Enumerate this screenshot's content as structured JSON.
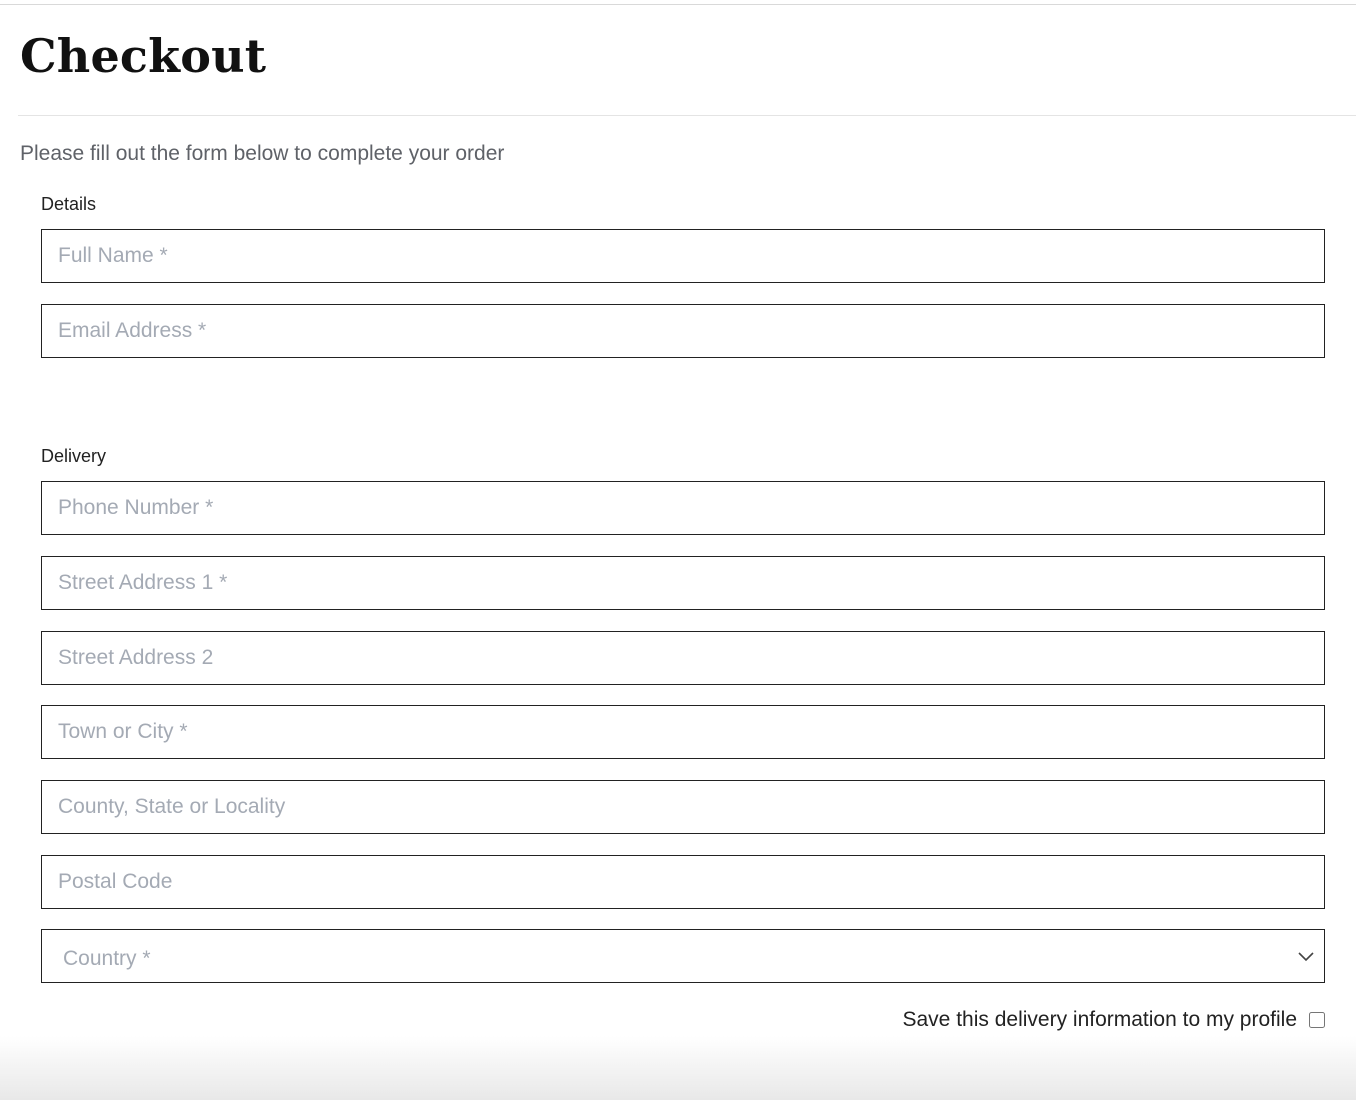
{
  "page": {
    "title": "Checkout",
    "intro": "Please fill out the form below to complete your order"
  },
  "details": {
    "label": "Details",
    "full_name_placeholder": "Full Name *",
    "email_placeholder": "Email Address *"
  },
  "delivery": {
    "label": "Delivery",
    "phone_placeholder": "Phone Number *",
    "street1_placeholder": "Street Address 1 *",
    "street2_placeholder": "Street Address 2",
    "town_placeholder": "Town or City *",
    "county_placeholder": "County, State or Locality",
    "postcode_placeholder": "Postal Code",
    "country_selected": "Country *",
    "save_label": "Save this delivery information to my profile",
    "save_checked": false
  },
  "icons": {
    "country_dropdown": "chevron-down-icon"
  },
  "colors": {
    "placeholder": "#a4aab4",
    "border": "#222222",
    "intro_text": "#5f6268"
  }
}
